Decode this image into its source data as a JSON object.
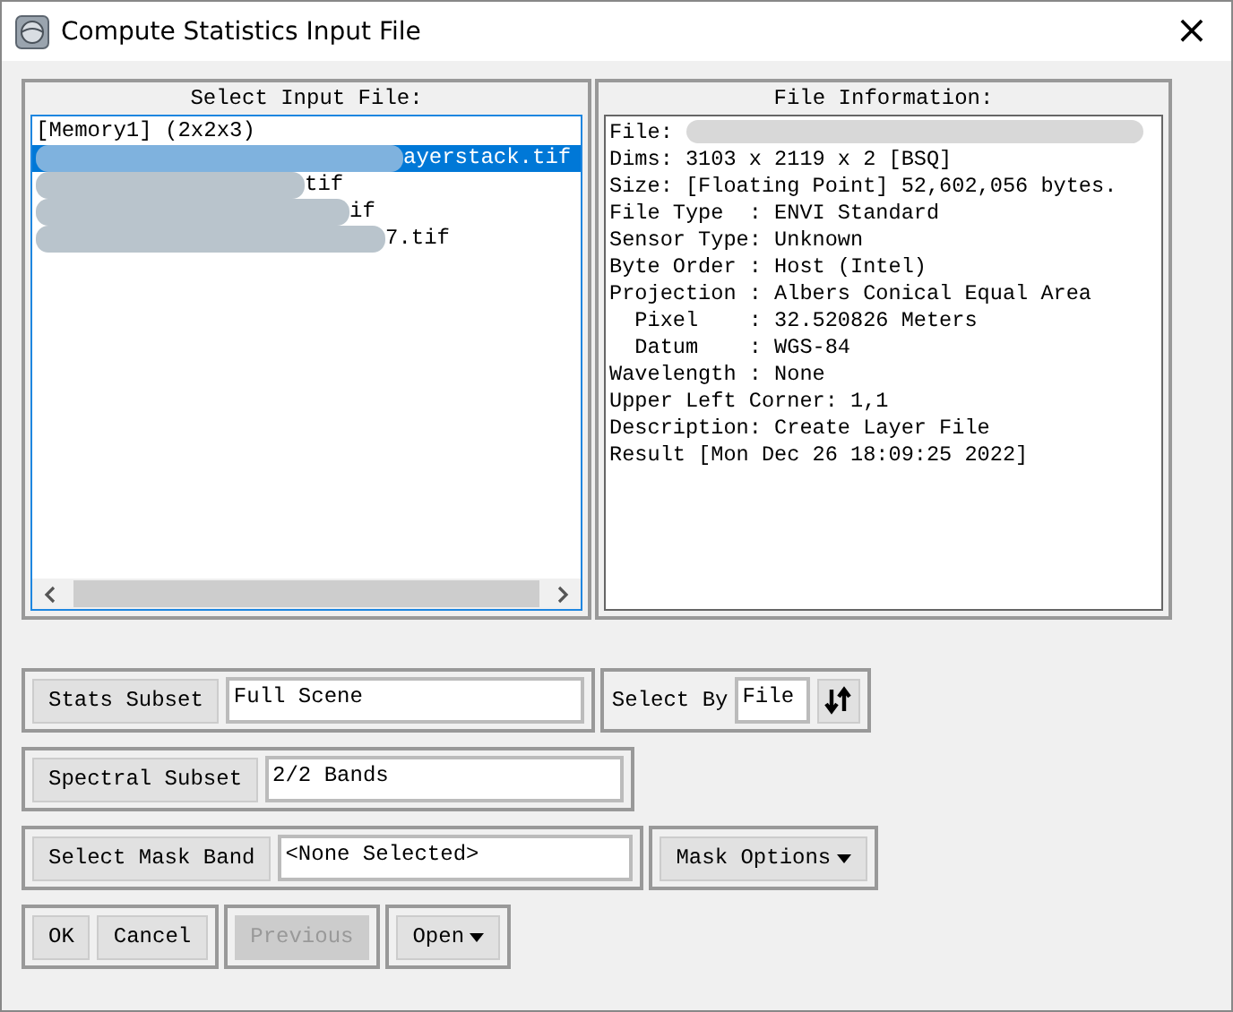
{
  "window": {
    "title": "Compute Statistics Input File",
    "close": "×"
  },
  "input_files": {
    "heading": "Select Input File:",
    "items": [
      {
        "text": "[Memory1] (2x2x3)",
        "selected": false,
        "redacted": false
      },
      {
        "text": "ayerstack.tif",
        "selected": true,
        "redacted": true
      },
      {
        "text": "tif",
        "selected": false,
        "redacted": true
      },
      {
        "text": "if",
        "selected": false,
        "redacted": true
      },
      {
        "text": "7.tif",
        "selected": false,
        "redacted": true
      }
    ]
  },
  "file_info": {
    "heading": "File Information:",
    "lines": [
      {
        "text": "File:",
        "redacted": true
      },
      {
        "text": "Dims: 3103 x 2119 x 2 [BSQ]",
        "redacted": false
      },
      {
        "text": "Size: [Floating Point] 52,602,056 bytes.",
        "redacted": false
      },
      {
        "text": "File Type  : ENVI Standard",
        "redacted": false
      },
      {
        "text": "Sensor Type: Unknown",
        "redacted": false
      },
      {
        "text": "Byte Order : Host (Intel)",
        "redacted": false
      },
      {
        "text": "Projection : Albers Conical Equal Area",
        "redacted": false
      },
      {
        "text": "  Pixel    : 32.520826 Meters",
        "redacted": false
      },
      {
        "text": "  Datum    : WGS-84",
        "redacted": false
      },
      {
        "text": "Wavelength : None",
        "redacted": false
      },
      {
        "text": "Upper Left Corner: 1,1",
        "redacted": false
      },
      {
        "text": "Description: Create Layer File",
        "redacted": false
      },
      {
        "text": "Result [Mon Dec 26 18:09:25 2022]",
        "redacted": false
      }
    ]
  },
  "stats_subset": {
    "button": "Stats Subset",
    "value": "Full Scene"
  },
  "select_by": {
    "label": "Select By",
    "value": "File"
  },
  "spectral_subset": {
    "button": "Spectral Subset",
    "value": "2/2 Bands"
  },
  "mask_band": {
    "button": "Select Mask Band",
    "value": "<None Selected>"
  },
  "mask_options": {
    "label": "Mask Options",
    "kind": "dropdown"
  },
  "action_groups": [
    [
      {
        "label": "OK",
        "kind": "button",
        "disabled": false
      },
      {
        "label": "Cancel",
        "kind": "button",
        "disabled": false
      }
    ],
    [
      {
        "label": "Previous",
        "kind": "button",
        "disabled": true
      }
    ],
    [
      {
        "label": "Open",
        "kind": "dropdown",
        "disabled": false
      }
    ]
  ]
}
